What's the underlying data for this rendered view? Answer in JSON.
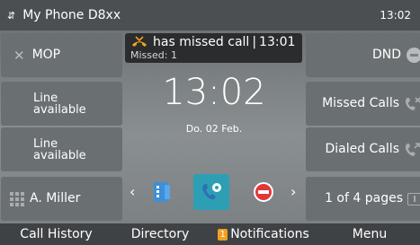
{
  "status_bar": {
    "device_name": "My Phone D8xx",
    "time": "13:02"
  },
  "notification": {
    "title": "has missed call",
    "time": "13:01",
    "subtitle": "Missed: 1"
  },
  "clock": {
    "time": "13:02",
    "date": "Do. 02 Feb."
  },
  "left_keys": [
    {
      "label": "MOP",
      "icon": "x-icon"
    },
    {
      "label": "Line\navailable",
      "icon": null
    },
    {
      "label": "Line\navailable",
      "icon": null
    },
    {
      "label": "A. Miller",
      "icon": "keypad-grid-icon"
    }
  ],
  "right_keys": [
    {
      "label": "DND",
      "icon": "dnd-icon"
    },
    {
      "label": "Missed Calls",
      "icon": "missed-call-icon"
    },
    {
      "label": "Dialed Calls",
      "icon": "dialed-call-icon"
    },
    {
      "label": "1 of 4 pages",
      "icon": "page-icon"
    }
  ],
  "dock": {
    "apps": [
      "directory-app-icon",
      "call-settings-app-icon",
      "block-icon"
    ],
    "selected_index": 1,
    "accent": "#2d9fb4"
  },
  "softkeys": {
    "call_history": "Call History",
    "directory": "Directory",
    "notifications": "Notifications",
    "notifications_count": "1",
    "menu": "Menu"
  },
  "colors": {
    "notification_badge": "#f0a020",
    "block": "#e23737",
    "missed_icon": "#f0a020"
  }
}
